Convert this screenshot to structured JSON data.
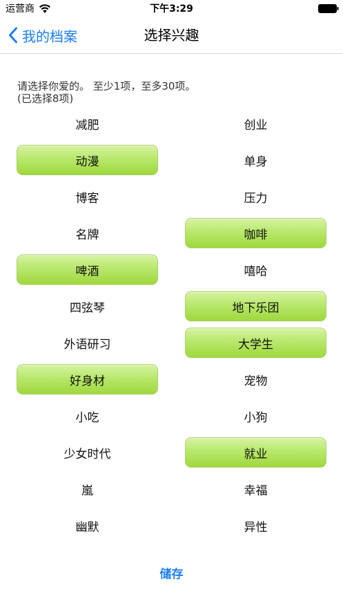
{
  "status_bar": {
    "carrier": "运营商",
    "time": "下午3:29"
  },
  "nav": {
    "back_label": "我的档案",
    "title": "选择兴趣"
  },
  "instruction": {
    "line1": "请选择你爱的。 至少1项，至多30项。",
    "line2": "(已选择8项)"
  },
  "interests": [
    {
      "label": "减肥",
      "selected": false
    },
    {
      "label": "创业",
      "selected": false
    },
    {
      "label": "动漫",
      "selected": true
    },
    {
      "label": "单身",
      "selected": false
    },
    {
      "label": "博客",
      "selected": false
    },
    {
      "label": "压力",
      "selected": false
    },
    {
      "label": "名牌",
      "selected": false
    },
    {
      "label": "咖啡",
      "selected": true
    },
    {
      "label": "啤酒",
      "selected": true
    },
    {
      "label": "嘻哈",
      "selected": false
    },
    {
      "label": "四弦琴",
      "selected": false
    },
    {
      "label": "地下乐团",
      "selected": true
    },
    {
      "label": "外语研习",
      "selected": false
    },
    {
      "label": "大学生",
      "selected": true
    },
    {
      "label": "好身材",
      "selected": true
    },
    {
      "label": "宠物",
      "selected": false
    },
    {
      "label": "小吃",
      "selected": false
    },
    {
      "label": "小狗",
      "selected": false
    },
    {
      "label": "少女时代",
      "selected": false
    },
    {
      "label": "就业",
      "selected": true
    },
    {
      "label": "嵐",
      "selected": false
    },
    {
      "label": "幸福",
      "selected": false
    },
    {
      "label": "幽默",
      "selected": false
    },
    {
      "label": "异性",
      "selected": false
    }
  ],
  "save_label": "储存",
  "colors": {
    "accent": "#1a7ef6",
    "selected_top": "#d6f3a2",
    "selected_bottom": "#9fd83d"
  },
  "icons": {
    "wifi": "wifi-icon",
    "battery": "battery-icon",
    "back": "chevron-left-icon"
  }
}
